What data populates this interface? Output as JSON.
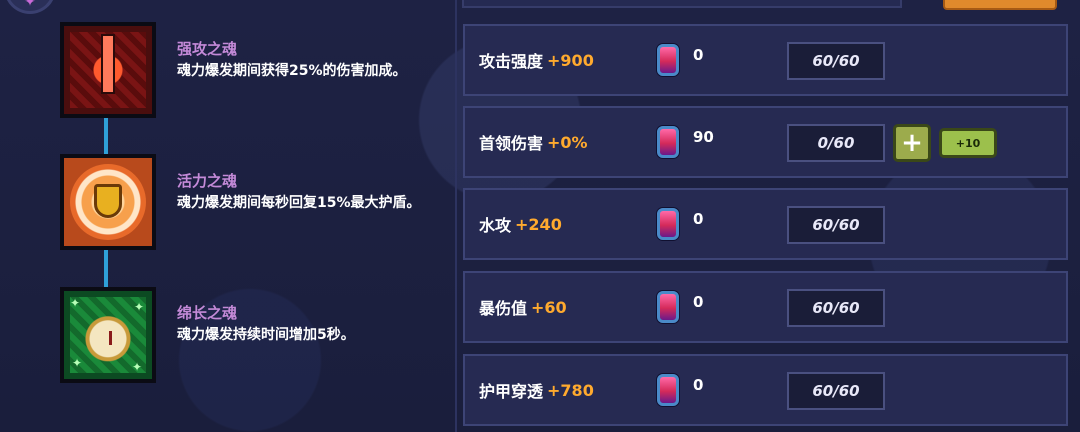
{
  "souls": [
    {
      "name": "强攻之魂",
      "desc": "魂力爆发期间获得25%的伤害加成。"
    },
    {
      "name": "活力之魂",
      "desc": "魂力爆发期间每秒回复15%最大护盾。"
    },
    {
      "name": "绵长之魂",
      "desc": "魂力爆发持续时间增加5秒。"
    }
  ],
  "stats": [
    {
      "label": "攻击强度",
      "bonus": "+900",
      "gems": "0",
      "level": "60/60"
    },
    {
      "label": "首领伤害",
      "bonus": "+0%",
      "gems": "90",
      "level": "0/60",
      "plus_label": "+",
      "plus10_label": "+10"
    },
    {
      "label": "水攻",
      "bonus": "+240",
      "gems": "0",
      "level": "60/60"
    },
    {
      "label": "暴伤值",
      "bonus": "+60",
      "gems": "0",
      "level": "60/60"
    },
    {
      "label": "护甲穿透",
      "bonus": "+780",
      "gems": "0",
      "level": "60/60"
    }
  ],
  "icons": {
    "top_badge": "soul-emblem-icon",
    "gem": "soul-gem-icon",
    "soul_1": "flame-sword-icon",
    "soul_2": "shield-icon",
    "soul_3": "stopwatch-icon"
  },
  "colors": {
    "soul_name": "#c48ad8",
    "bonus": "#ffaa2e",
    "plus_button": "#9cab4c"
  }
}
